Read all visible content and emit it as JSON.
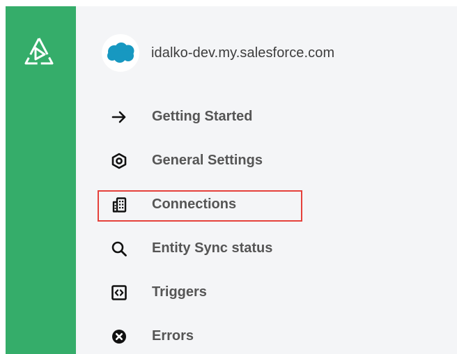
{
  "instance": {
    "avatar_icon": "salesforce-cloud-icon",
    "name": "idalko-dev.my.salesforce.com"
  },
  "nav": {
    "items": [
      {
        "label": "Getting Started",
        "icon": "arrow-right-icon"
      },
      {
        "label": "General Settings",
        "icon": "hexagon-settings-icon"
      },
      {
        "label": "Connections",
        "icon": "building-icon",
        "highlighted": true
      },
      {
        "label": "Entity Sync status",
        "icon": "search-icon"
      },
      {
        "label": "Triggers",
        "icon": "code-brackets-icon"
      },
      {
        "label": "Errors",
        "icon": "error-circle-icon"
      }
    ]
  },
  "colors": {
    "rail": "#35ad6a",
    "background": "#f4f5f7",
    "highlight_border": "#e5413b",
    "salesforce_blue": "#1798c1"
  }
}
